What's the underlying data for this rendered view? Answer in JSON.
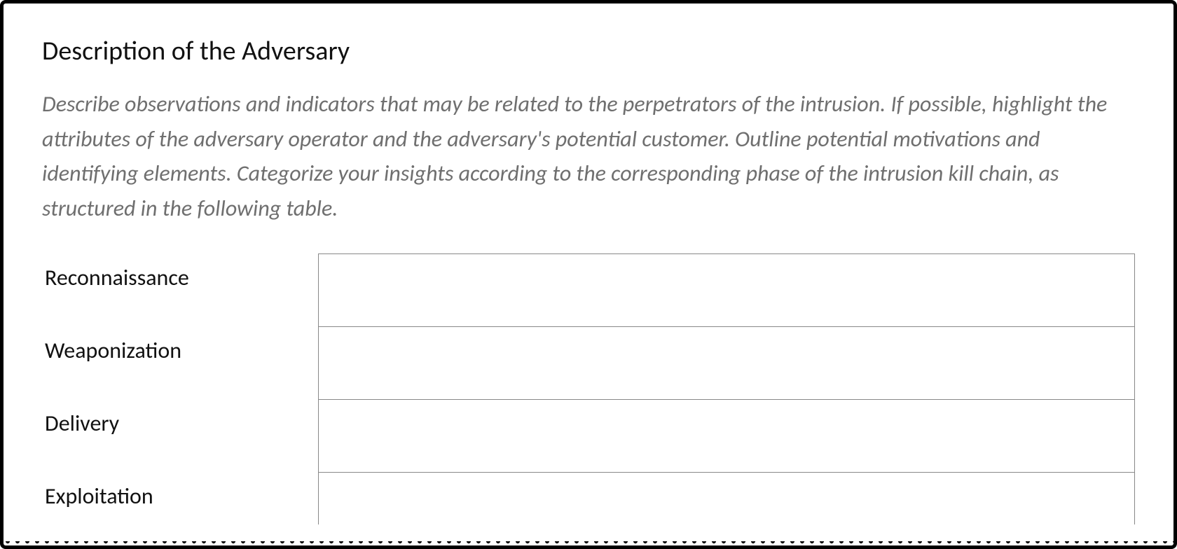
{
  "section": {
    "title": "Description of the Adversary",
    "instructions": "Describe observations and indicators that may be related to the perpetrators of the intrusion. If possible, highlight the attributes of the adversary operator and the adversary's potential customer. Outline potential motivations and identifying elements. Categorize your insights according to the corresponding phase of the intrusion kill chain, as structured in the following table."
  },
  "kill_chain": {
    "rows": [
      {
        "label": "Reconnaissance",
        "value": ""
      },
      {
        "label": "Weaponization",
        "value": ""
      },
      {
        "label": "Delivery",
        "value": ""
      },
      {
        "label": "Exploitation",
        "value": ""
      }
    ]
  }
}
